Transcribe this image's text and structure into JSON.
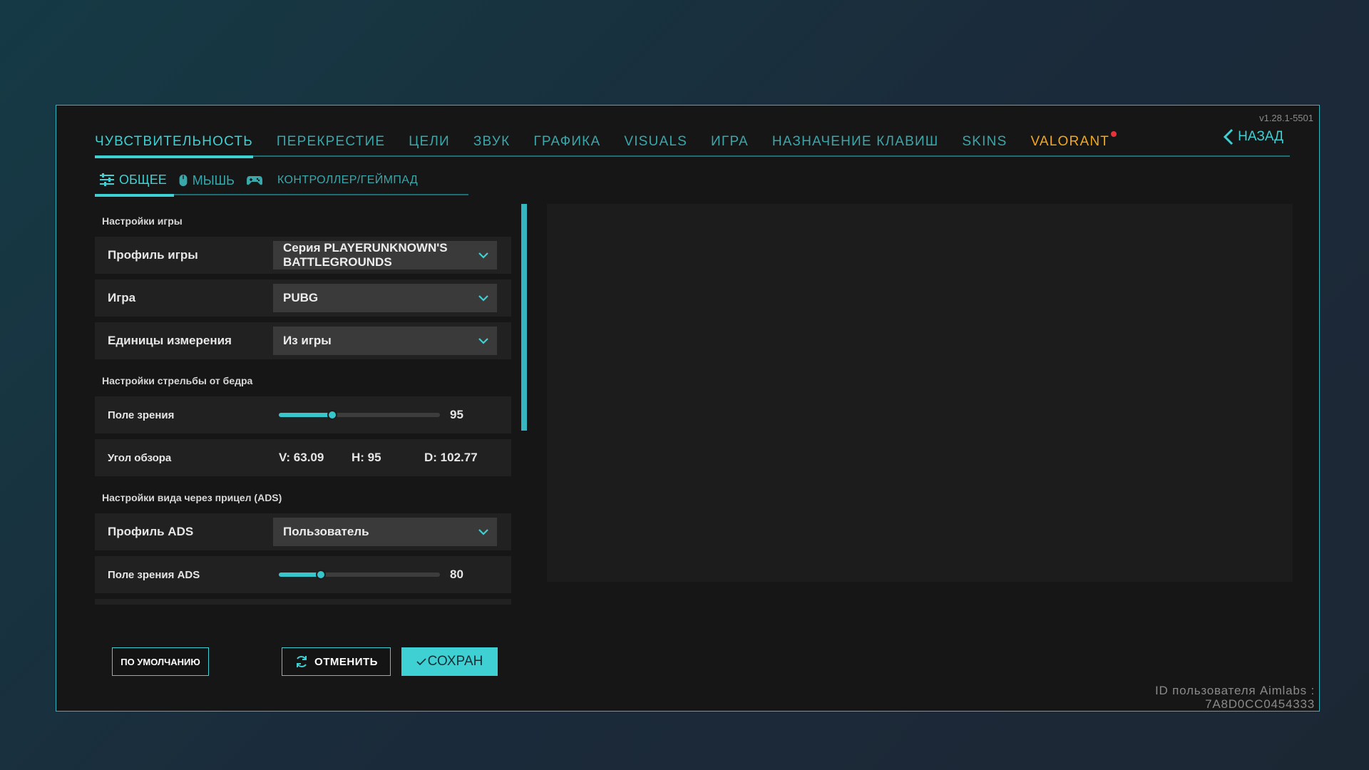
{
  "version": "v1.28.1-5501",
  "top_tabs": [
    {
      "label": "ЧУВСТВИТЕЛЬНОСТЬ",
      "state": "active"
    },
    {
      "label": "ПЕРЕКРЕСТИЕ",
      "state": "normal"
    },
    {
      "label": "ЦЕЛИ",
      "state": "normal"
    },
    {
      "label": "ЗВУК",
      "state": "normal"
    },
    {
      "label": "ГРАФИКА",
      "state": "normal"
    },
    {
      "label": "VISUALS",
      "state": "normal"
    },
    {
      "label": "ИГРА",
      "state": "normal"
    },
    {
      "label": "НАЗНАЧЕНИЕ КЛАВИШ",
      "state": "normal"
    },
    {
      "label": "SKINS",
      "state": "normal"
    },
    {
      "label": "VALORANT",
      "state": "accent",
      "notification": true
    }
  ],
  "back_button": {
    "label": "НАЗАД",
    "icon": "chevron-left-icon"
  },
  "sub_tabs": [
    {
      "label": "ОБЩЕЕ",
      "icon": "sliders-icon",
      "state": "active"
    },
    {
      "label": "МЫШЬ",
      "icon": "mouse-icon",
      "state": "normal"
    },
    {
      "label": "КОНТРОЛЛЕР/ГЕЙМПАД",
      "icon": "gamepad-icon",
      "state": "normal"
    }
  ],
  "sections": {
    "game_settings": {
      "title": "Настройки игры",
      "game_profile": {
        "label": "Профиль игры",
        "value": "Серия PLAYERUNKNOWN'S BATTLEGROUNDS"
      },
      "game": {
        "label": "Игра",
        "value": "PUBG"
      },
      "units": {
        "label": "Единицы измерения",
        "value": "Из игры"
      }
    },
    "hipfire": {
      "title": "Настройки стрельбы от бедра",
      "fov": {
        "label": "Поле зрения",
        "value": "95",
        "level": 0.33
      },
      "view_angle": {
        "label": "Угол обзора",
        "v": "V: 63.09",
        "h": "H: 95",
        "d": "D: 102.77"
      }
    },
    "ads": {
      "title": "Настройки вида через прицел (ADS)",
      "profile": {
        "label": "Профиль ADS",
        "value": "Пользователь"
      },
      "fov": {
        "label": "Поле зрения ADS",
        "value": "80",
        "level": 0.26
      }
    }
  },
  "buttons": {
    "default": "ПО УМОЛЧАНИЮ",
    "cancel": "ОТМЕНИТЬ",
    "save": "СОХРАН"
  },
  "user_id": {
    "label": "ID пользователя Aimlabs :",
    "value": "7A8D0CC0454333"
  },
  "colors": {
    "accent": "#3fd0d3",
    "valorant": "#f2a81d",
    "notification": "#e8333a",
    "panel": "#161616",
    "row": "#212121"
  }
}
